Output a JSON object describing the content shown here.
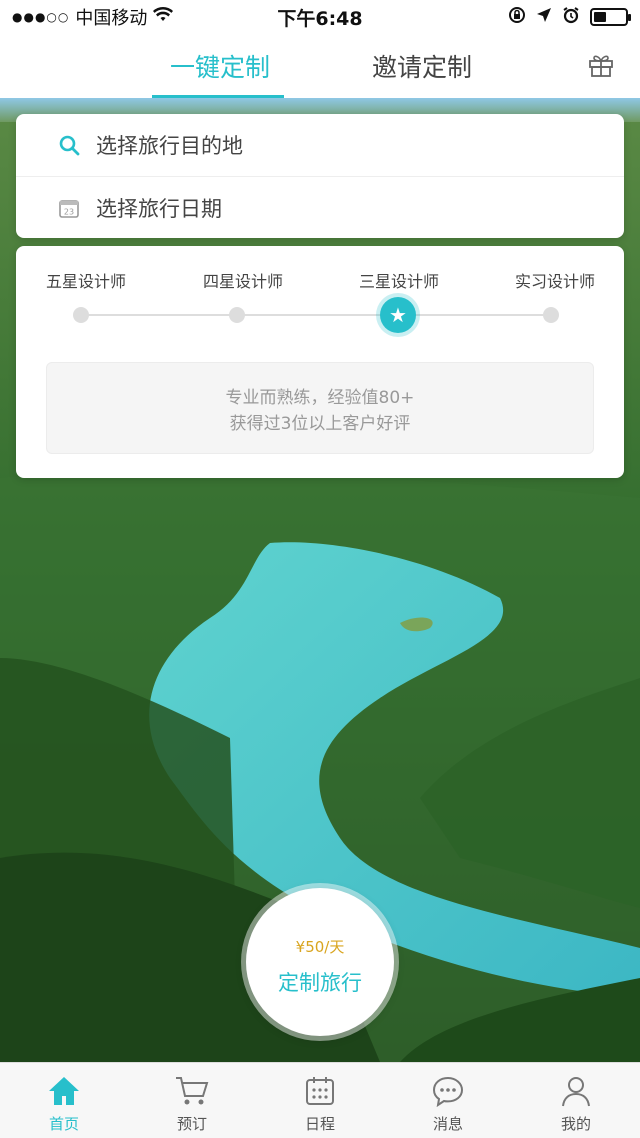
{
  "status_bar": {
    "signal": "●●●○○",
    "carrier": "中国移动",
    "time": "下午6:48"
  },
  "tabs": [
    {
      "label": "一键定制",
      "active": true
    },
    {
      "label": "邀请定制",
      "active": false
    }
  ],
  "search": {
    "destination_placeholder": "选择旅行目的地",
    "date_placeholder": "选择旅行日期"
  },
  "designer_levels": {
    "levels": [
      "五星设计师",
      "四星设计师",
      "三星设计师",
      "实习设计师"
    ],
    "selected_index": 2,
    "description_line1": "专业而熟练，经验值80+",
    "description_line2": "获得过3位以上客户好评"
  },
  "cta": {
    "price": "¥50/天",
    "label": "定制旅行"
  },
  "bottom_nav": [
    {
      "label": "首页",
      "icon": "home-icon",
      "active": true
    },
    {
      "label": "预订",
      "icon": "cart-icon",
      "active": false
    },
    {
      "label": "日程",
      "icon": "calendar-icon",
      "active": false
    },
    {
      "label": "消息",
      "icon": "message-icon",
      "active": false
    },
    {
      "label": "我的",
      "icon": "user-icon",
      "active": false
    }
  ],
  "colors": {
    "accent": "#27bfcb",
    "price": "#d9a520"
  }
}
